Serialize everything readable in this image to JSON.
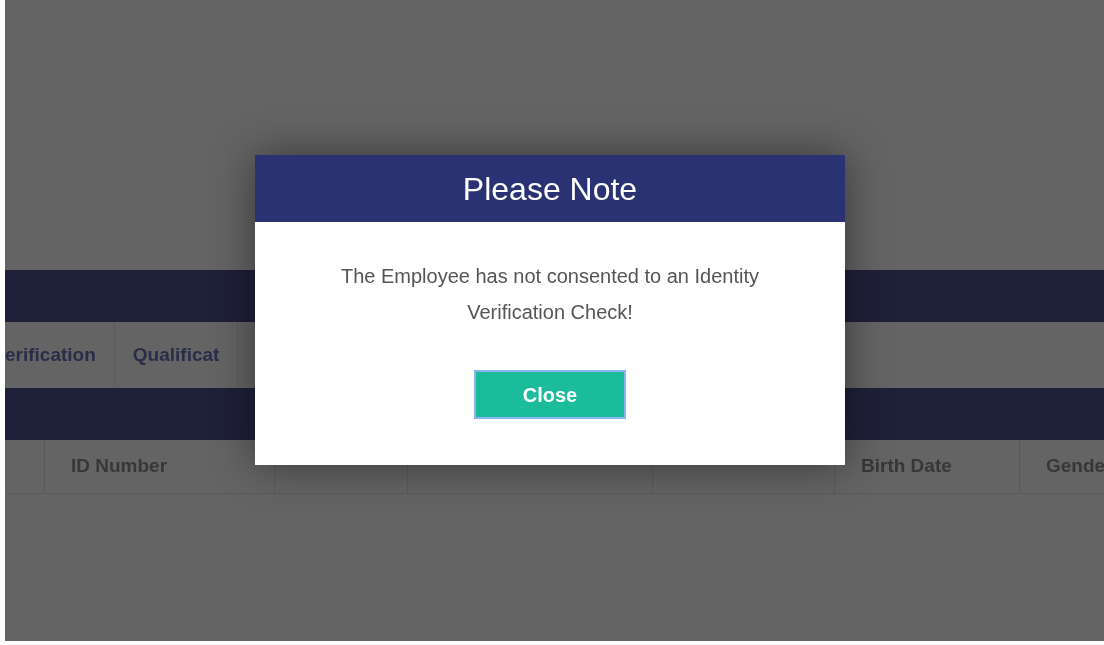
{
  "tabs": [
    {
      "label": "erification"
    },
    {
      "label": "Qualificat"
    }
  ],
  "table": {
    "columns": [
      "ID Number",
      "Birth Date",
      "Gende"
    ]
  },
  "modal": {
    "title": "Please Note",
    "message": "The Employee has not consented to an Identity Verification Check!",
    "button": "Close"
  }
}
